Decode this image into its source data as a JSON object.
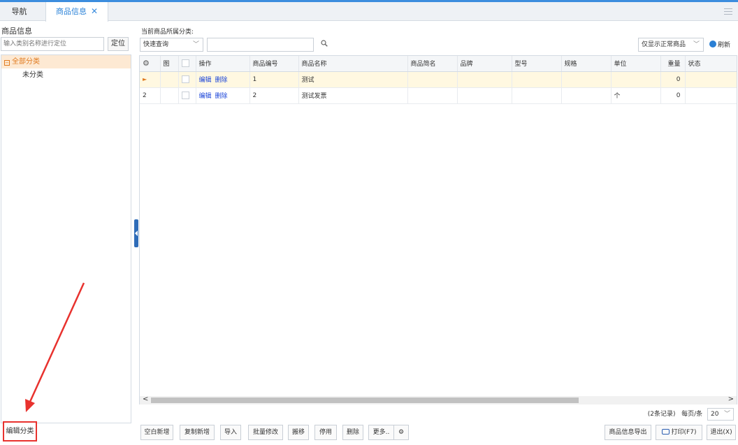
{
  "tabs": {
    "nav": "导航",
    "goods": "商品信息",
    "close": "✕"
  },
  "left": {
    "title": "商品信息",
    "locate_placeholder": "输入类别名称进行定位",
    "locate_button": "定位",
    "tree_root": "全部分类",
    "tree_root_toggle": "−",
    "tree_children": [
      "未分类"
    ],
    "edit_category_button": "编辑分类"
  },
  "toolbar": {
    "category_label": "当前商品所属分类:",
    "quick_query": "快速查询",
    "filter_option": "仅显示正常商品",
    "refresh": "刷新"
  },
  "grid": {
    "columns": [
      "图",
      "操作",
      "商品编号",
      "商品名称",
      "商品简名",
      "品牌",
      "型号",
      "规格",
      "单位",
      "重量",
      "状态"
    ],
    "edit_link": "编辑",
    "delete_link": "删除",
    "rows": [
      {
        "marker": "►",
        "code": "1",
        "name": "测试",
        "unit": "",
        "weight": "0"
      },
      {
        "marker": "2",
        "code": "2",
        "name": "测试发票",
        "unit": "个",
        "weight": "0"
      }
    ]
  },
  "pager": {
    "records": "(2条记录)",
    "per_page_label": "每页/条",
    "per_page": "20"
  },
  "bottom": {
    "blank_new": "空白新增",
    "copy_new": "复制新增",
    "import": "导入",
    "batch_edit": "批量修改",
    "move": "搬移",
    "disable": "停用",
    "delete": "删除",
    "more": "更多..",
    "export": "商品信息导出",
    "print": "打印(F7)",
    "exit": "退出(X)"
  },
  "colors": {
    "accent": "#3c8dde",
    "highlight_row": "#fff8e1",
    "tree_selected": "#fde9d3",
    "annotation": "#e8322e"
  }
}
